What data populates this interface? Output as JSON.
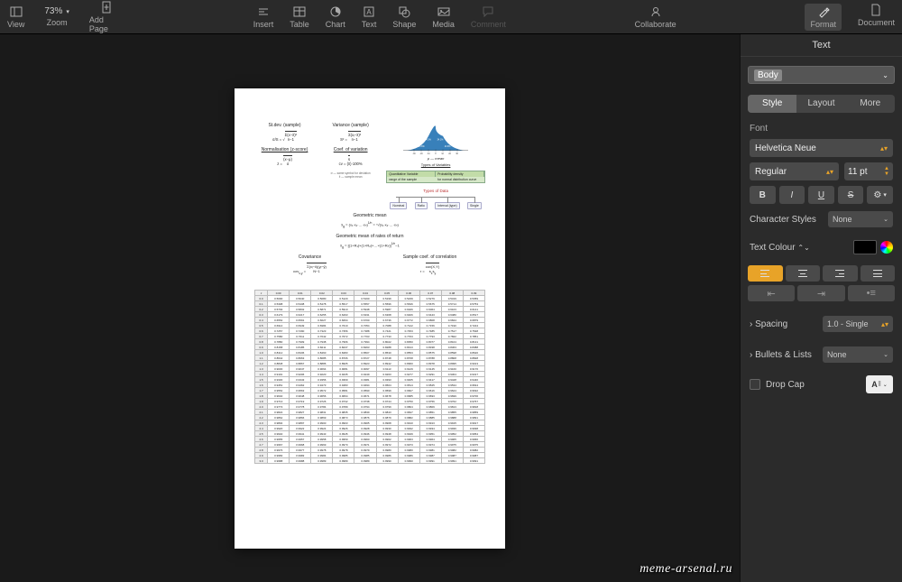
{
  "toolbar": {
    "view": "View",
    "zoom_value": "73%",
    "zoom": "Zoom",
    "add_page": "Add Page",
    "insert": "Insert",
    "table": "Table",
    "chart": "Chart",
    "text": "Text",
    "shape": "Shape",
    "media": "Media",
    "comment": "Comment",
    "collaborate": "Collaborate",
    "format": "Format",
    "document": "Document"
  },
  "inspector": {
    "title": "Text",
    "paragraph_style": "Body",
    "tabs": {
      "style": "Style",
      "layout": "Layout",
      "more": "More"
    },
    "font_label": "Font",
    "font_family": "Helvetica Neue",
    "font_weight": "Regular",
    "font_size": "11 pt",
    "bius": {
      "b": "B",
      "i": "I",
      "u": "U",
      "s": "S"
    },
    "char_styles_label": "Character Styles",
    "char_styles_value": "None",
    "text_color_label": "Text Colour",
    "spacing_label": "Spacing",
    "spacing_value": "1.0 - Single",
    "bullets_label": "Bullets & Lists",
    "bullets_value": "None",
    "dropcap_label": "Drop Cap"
  },
  "page": {
    "stdev_title": "St.dev. (sample)",
    "variance_title": "Variance (sample)",
    "normalisation_title": "Normalisation (z-score)",
    "coef_var_title": "Coef. of variation",
    "geomean_title": "Geometric mean",
    "geomean_ror_title": "Geometric mean of rates of return",
    "covariance_title": "Covariance",
    "sample_corr_title": "Sample coef. of correlation",
    "mean_label": "μ  —  mean",
    "types_line": "Types of Variables",
    "legend_hdr1": "Quantitative Variable",
    "legend_hdr2": "Probability density",
    "types_title": "Types of Data",
    "types": [
      "Nominal",
      "Ratio",
      "Interval (type)",
      "Single"
    ],
    "ztable_cols": [
      "0.00",
      "0.01",
      "0.02",
      "0.03",
      "0.04",
      "0.05",
      "0.06",
      "0.07",
      "0.08",
      "0.09"
    ],
    "ztable_rows": [
      "0.0",
      "0.1",
      "0.2",
      "0.3",
      "0.4",
      "0.5",
      "0.6",
      "0.7",
      "0.8",
      "0.9",
      "1.0",
      "1.1",
      "1.2",
      "1.3",
      "1.4",
      "1.5",
      "1.6",
      "1.7",
      "1.8",
      "1.9",
      "2.0",
      "2.1",
      "2.2",
      "2.3",
      "2.4",
      "2.5",
      "2.6",
      "2.7",
      "2.8",
      "2.9",
      "3.0"
    ]
  },
  "watermark": "meme-arsenal.ru"
}
